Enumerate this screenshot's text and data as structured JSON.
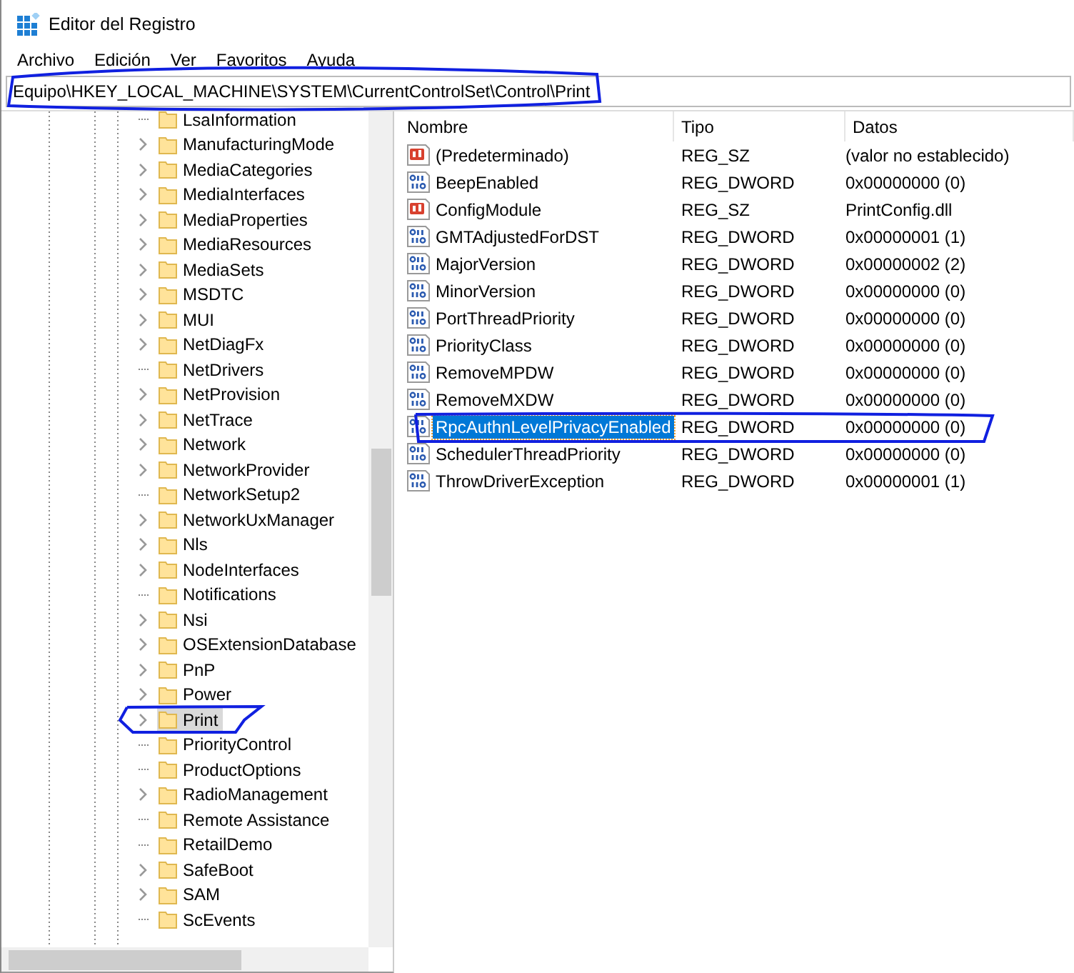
{
  "window": {
    "title": "Editor del Registro"
  },
  "menu": [
    "Archivo",
    "Edición",
    "Ver",
    "Favoritos",
    "Ayuda"
  ],
  "address": {
    "value": "Equipo\\HKEY_LOCAL_MACHINE\\SYSTEM\\CurrentControlSet\\Control\\Print"
  },
  "tree": {
    "items": [
      {
        "label": "LsaInformation",
        "expandable": false,
        "selected": false
      },
      {
        "label": "ManufacturingMode",
        "expandable": true,
        "selected": false
      },
      {
        "label": "MediaCategories",
        "expandable": true,
        "selected": false
      },
      {
        "label": "MediaInterfaces",
        "expandable": true,
        "selected": false
      },
      {
        "label": "MediaProperties",
        "expandable": true,
        "selected": false
      },
      {
        "label": "MediaResources",
        "expandable": true,
        "selected": false
      },
      {
        "label": "MediaSets",
        "expandable": true,
        "selected": false
      },
      {
        "label": "MSDTC",
        "expandable": true,
        "selected": false
      },
      {
        "label": "MUI",
        "expandable": true,
        "selected": false
      },
      {
        "label": "NetDiagFx",
        "expandable": true,
        "selected": false
      },
      {
        "label": "NetDrivers",
        "expandable": false,
        "selected": false
      },
      {
        "label": "NetProvision",
        "expandable": true,
        "selected": false
      },
      {
        "label": "NetTrace",
        "expandable": true,
        "selected": false
      },
      {
        "label": "Network",
        "expandable": true,
        "selected": false
      },
      {
        "label": "NetworkProvider",
        "expandable": true,
        "selected": false
      },
      {
        "label": "NetworkSetup2",
        "expandable": false,
        "selected": false
      },
      {
        "label": "NetworkUxManager",
        "expandable": true,
        "selected": false
      },
      {
        "label": "Nls",
        "expandable": true,
        "selected": false
      },
      {
        "label": "NodeInterfaces",
        "expandable": true,
        "selected": false
      },
      {
        "label": "Notifications",
        "expandable": false,
        "selected": false
      },
      {
        "label": "Nsi",
        "expandable": true,
        "selected": false
      },
      {
        "label": "OSExtensionDatabase",
        "expandable": true,
        "selected": false
      },
      {
        "label": "PnP",
        "expandable": true,
        "selected": false
      },
      {
        "label": "Power",
        "expandable": true,
        "selected": false
      },
      {
        "label": "Print",
        "expandable": true,
        "selected": true
      },
      {
        "label": "PriorityControl",
        "expandable": false,
        "selected": false
      },
      {
        "label": "ProductOptions",
        "expandable": false,
        "selected": false
      },
      {
        "label": "RadioManagement",
        "expandable": true,
        "selected": false
      },
      {
        "label": "Remote Assistance",
        "expandable": false,
        "selected": false
      },
      {
        "label": "RetailDemo",
        "expandable": false,
        "selected": false
      },
      {
        "label": "SafeBoot",
        "expandable": true,
        "selected": false
      },
      {
        "label": "SAM",
        "expandable": true,
        "selected": false
      },
      {
        "label": "ScEvents",
        "expandable": false,
        "selected": false
      }
    ]
  },
  "values": {
    "columns": [
      "Nombre",
      "Tipo",
      "Datos"
    ],
    "rows": [
      {
        "kind": "string",
        "name": "(Predeterminado)",
        "type": "REG_SZ",
        "data": "(valor no establecido)",
        "selected": false
      },
      {
        "kind": "dword",
        "name": "BeepEnabled",
        "type": "REG_DWORD",
        "data": "0x00000000 (0)",
        "selected": false
      },
      {
        "kind": "string",
        "name": "ConfigModule",
        "type": "REG_SZ",
        "data": "PrintConfig.dll",
        "selected": false
      },
      {
        "kind": "dword",
        "name": "GMTAdjustedForDST",
        "type": "REG_DWORD",
        "data": "0x00000001 (1)",
        "selected": false
      },
      {
        "kind": "dword",
        "name": "MajorVersion",
        "type": "REG_DWORD",
        "data": "0x00000002 (2)",
        "selected": false
      },
      {
        "kind": "dword",
        "name": "MinorVersion",
        "type": "REG_DWORD",
        "data": "0x00000000 (0)",
        "selected": false
      },
      {
        "kind": "dword",
        "name": "PortThreadPriority",
        "type": "REG_DWORD",
        "data": "0x00000000 (0)",
        "selected": false
      },
      {
        "kind": "dword",
        "name": "PriorityClass",
        "type": "REG_DWORD",
        "data": "0x00000000 (0)",
        "selected": false
      },
      {
        "kind": "dword",
        "name": "RemoveMPDW",
        "type": "REG_DWORD",
        "data": "0x00000000 (0)",
        "selected": false
      },
      {
        "kind": "dword",
        "name": "RemoveMXDW",
        "type": "REG_DWORD",
        "data": "0x00000000 (0)",
        "selected": false
      },
      {
        "kind": "dword",
        "name": "RpcAuthnLevelPrivacyEnabled",
        "type": "REG_DWORD",
        "data": "0x00000000 (0)",
        "selected": true
      },
      {
        "kind": "dword",
        "name": "SchedulerThreadPriority",
        "type": "REG_DWORD",
        "data": "0x00000000 (0)",
        "selected": false
      },
      {
        "kind": "dword",
        "name": "ThrowDriverException",
        "type": "REG_DWORD",
        "data": "0x00000001 (1)",
        "selected": false
      }
    ]
  }
}
